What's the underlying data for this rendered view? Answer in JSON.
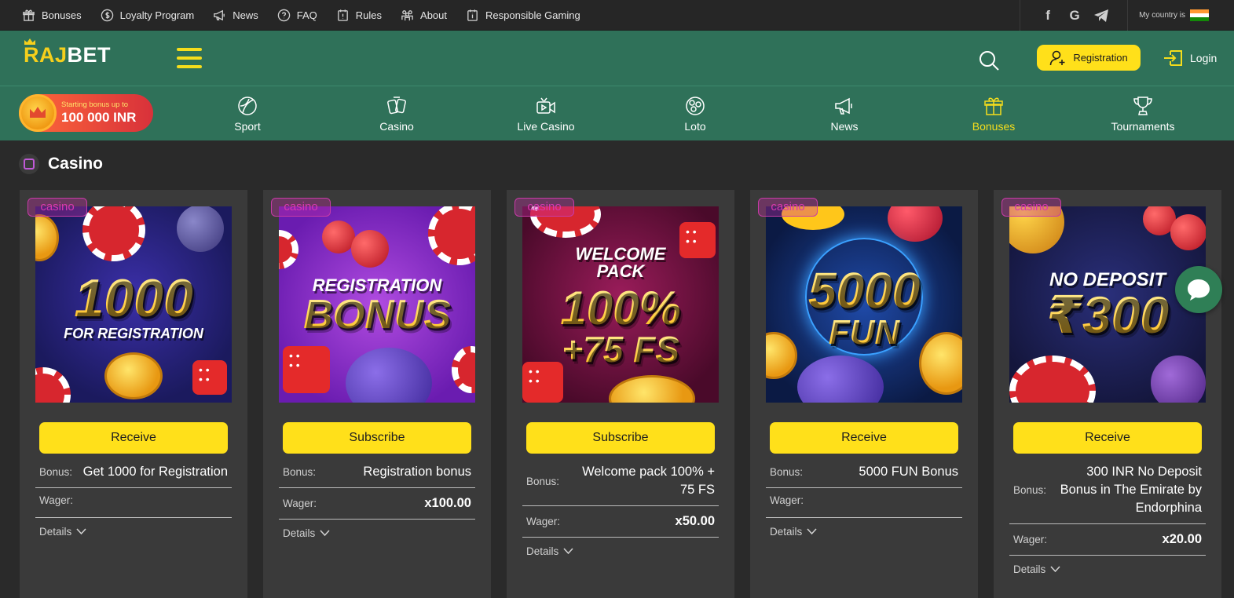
{
  "topnav": [
    {
      "label": "Bonuses",
      "icon": "gift-icon"
    },
    {
      "label": "Loyalty Program",
      "icon": "coin-icon"
    },
    {
      "label": "News",
      "icon": "megaphone-icon"
    },
    {
      "label": "FAQ",
      "icon": "question-icon"
    },
    {
      "label": "Rules",
      "icon": "rules-icon"
    },
    {
      "label": "About",
      "icon": "people-icon"
    },
    {
      "label": "Responsible Gaming",
      "icon": "info-clipboard-icon"
    }
  ],
  "social": {
    "facebook": "f",
    "google": "G",
    "telegram": "telegram"
  },
  "country": {
    "label": "My country is"
  },
  "header": {
    "logo_left": "RAJ",
    "logo_right": "BET",
    "registration": "Registration",
    "login": "Login"
  },
  "promo": {
    "line1": "Starting bonus up to",
    "line2": "100 000 INR"
  },
  "categories": [
    {
      "label": "Sport",
      "icon": "ball-icon",
      "active": false
    },
    {
      "label": "Casino",
      "icon": "cards-icon",
      "active": false
    },
    {
      "label": "Live Casino",
      "icon": "live-video-icon",
      "active": false
    },
    {
      "label": "Loto",
      "icon": "lotto-balls-icon",
      "active": false
    },
    {
      "label": "News",
      "icon": "megaphone-icon",
      "active": false
    },
    {
      "label": "Bonuses",
      "icon": "gift-icon",
      "active": true
    },
    {
      "label": "Tournaments",
      "icon": "trophy-icon",
      "active": false
    }
  ],
  "section": {
    "title": "Casino"
  },
  "cards": [
    {
      "tag": "casino",
      "art": {
        "l1": "",
        "l2": "1000",
        "l3": "FOR REGISTRATION",
        "bg": "#24216e"
      },
      "button": "Receive",
      "bonus_label": "Bonus:",
      "bonus": "Get 1000 for Registration",
      "wager_label": "Wager:",
      "wager": "",
      "details": "Details"
    },
    {
      "tag": "casino",
      "art": {
        "l1": "REGISTRATION",
        "l2": "BONUS",
        "l3": "",
        "bg": "#8a2cc7"
      },
      "button": "Subscribe",
      "bonus_label": "Bonus:",
      "bonus": "Registration bonus",
      "wager_label": "Wager:",
      "wager": "x100.00",
      "details": "Details"
    },
    {
      "tag": "casino",
      "art": {
        "l1": "WELCOME PACK",
        "l2": "100%",
        "l3": "+75 FS",
        "bg": "#6e1240"
      },
      "button": "Subscribe",
      "bonus_label": "Bonus:",
      "bonus": "Welcome pack 100% + 75 FS",
      "wager_label": "Wager:",
      "wager": "x50.00",
      "details": "Details"
    },
    {
      "tag": "casino",
      "art": {
        "l1": "",
        "l2": "5000",
        "l3": "FUN",
        "bg": "#0f2a5e"
      },
      "button": "Receive",
      "bonus_label": "Bonus:",
      "bonus": "5000 FUN Bonus",
      "wager_label": "Wager:",
      "wager": "",
      "details": "Details"
    },
    {
      "tag": "casino",
      "art": {
        "l1": "NO DEPOSIT",
        "l2": "₹300",
        "l3": "",
        "bg": "#1d1f4f"
      },
      "button": "Receive",
      "bonus_label": "Bonus:",
      "bonus": "300 INR No Deposit Bonus in The Emirate by Endorphina",
      "wager_label": "Wager:",
      "wager": "x20.00",
      "details": "Details"
    }
  ],
  "colors": {
    "green": "#2f7159",
    "yellow": "#ffe01a",
    "card_bg": "#3a3a3a",
    "page_bg": "#2a2a2a",
    "tag": "#d838b0"
  }
}
